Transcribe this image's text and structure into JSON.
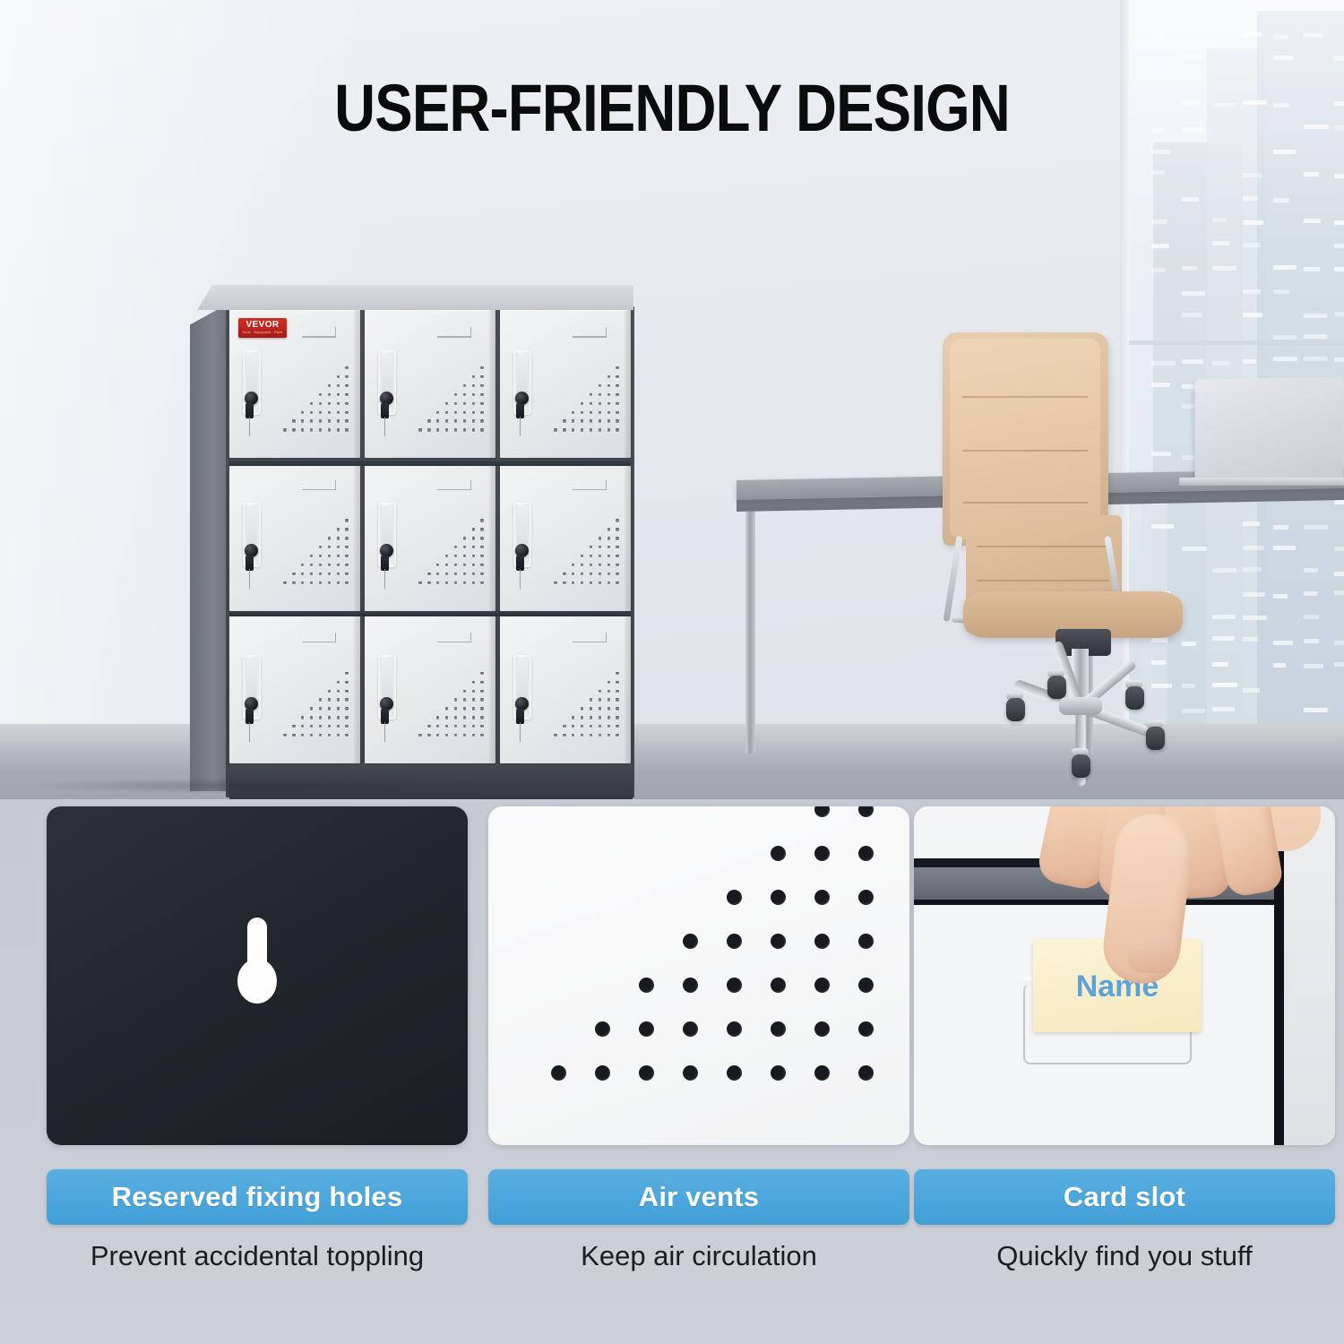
{
  "title": "USER-FRIENDLY DESIGN",
  "brand": {
    "name": "VEVOR",
    "tagline": "Tools · Equipment · Parts"
  },
  "scene": {
    "name": "office-locker-scene",
    "locker": {
      "rows": 3,
      "columns": 3,
      "door_count": 9,
      "body_color": "#444950",
      "door_color": "#eceef0",
      "doors": [
        {
          "id": "door-1-1",
          "vent_rows": 8
        },
        {
          "id": "door-1-2",
          "vent_rows": 8
        },
        {
          "id": "door-1-3",
          "vent_rows": 8
        },
        {
          "id": "door-2-1",
          "vent_rows": 8
        },
        {
          "id": "door-2-2",
          "vent_rows": 8
        },
        {
          "id": "door-2-3",
          "vent_rows": 8
        },
        {
          "id": "door-3-1",
          "vent_rows": 8
        },
        {
          "id": "door-3-2",
          "vent_rows": 8
        },
        {
          "id": "door-3-3",
          "vent_rows": 8
        }
      ]
    },
    "furniture": [
      "desk",
      "office-chair",
      "laptop",
      "window"
    ]
  },
  "features": [
    {
      "id": "reserved-fixing-holes",
      "badge_label": "Reserved fixing holes",
      "caption": "Prevent accidental toppling",
      "image": "keyhole-mounting-hole-on-black-panel"
    },
    {
      "id": "air-vents",
      "badge_label": "Air vents",
      "caption": "Keep air circulation",
      "image": "triangular-perforated-vent-dots"
    },
    {
      "id": "card-slot",
      "badge_label": "Card slot",
      "caption": "Quickly find you stuff",
      "image": "hand-inserting-name-card",
      "card_text": "Name"
    }
  ],
  "colors": {
    "badge_blue": "#48a4da",
    "title_black": "#0b0c0e",
    "brand_red": "#c42a21",
    "card_cream": "#f7ebc6",
    "card_text_blue": "#5fa3d6"
  }
}
